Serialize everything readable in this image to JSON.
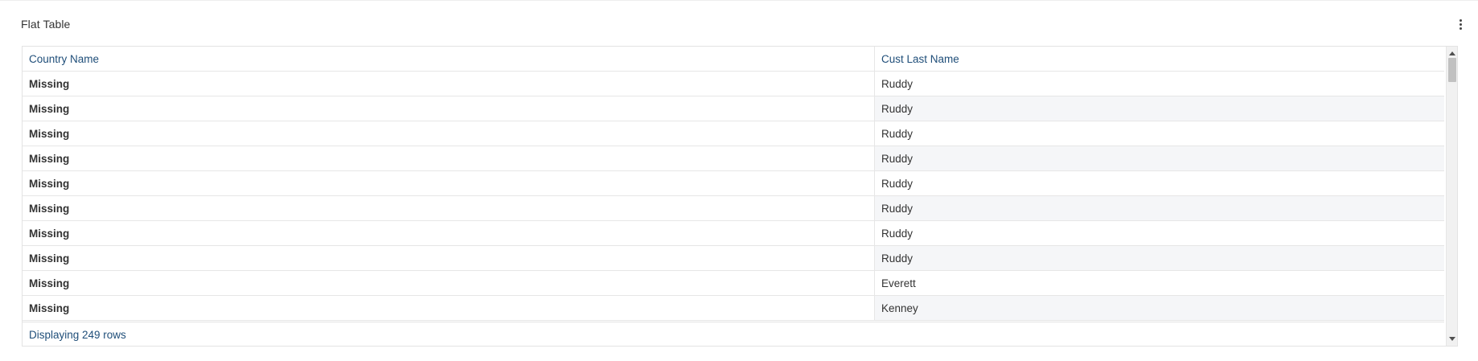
{
  "panel": {
    "title": "Flat Table",
    "menu_icon": "more-vertical-icon"
  },
  "table": {
    "columns": [
      "Country Name",
      "Cust Last Name"
    ],
    "rows": [
      [
        "Missing",
        "Ruddy"
      ],
      [
        "Missing",
        "Ruddy"
      ],
      [
        "Missing",
        "Ruddy"
      ],
      [
        "Missing",
        "Ruddy"
      ],
      [
        "Missing",
        "Ruddy"
      ],
      [
        "Missing",
        "Ruddy"
      ],
      [
        "Missing",
        "Ruddy"
      ],
      [
        "Missing",
        "Ruddy"
      ],
      [
        "Missing",
        "Everett"
      ],
      [
        "Missing",
        "Kenney"
      ]
    ],
    "footer": "Displaying 249 rows"
  },
  "colors": {
    "header_text": "#1f4e79",
    "alt_row": "#f5f6f8",
    "border": "#e6e6e6"
  }
}
